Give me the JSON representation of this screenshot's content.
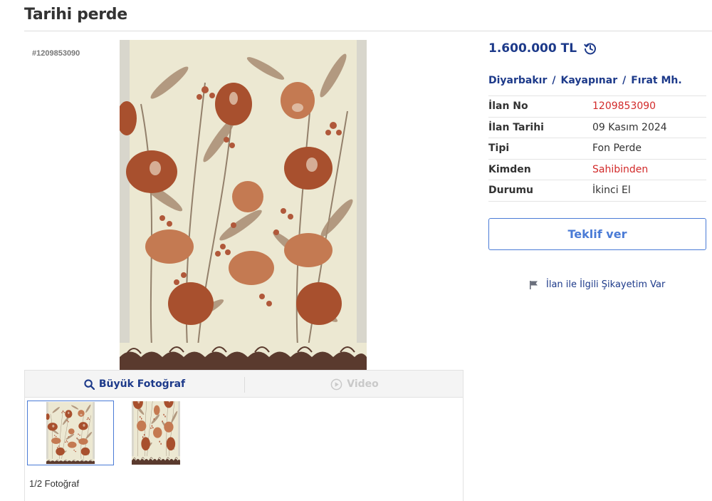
{
  "page": {
    "title": "Tarihi perde"
  },
  "listing": {
    "code": "#1209853090"
  },
  "gallery": {
    "big_photo_label": "Büyük Fotoğraf",
    "video_label": "Video",
    "counter": "1/2 Fotoğraf"
  },
  "price": {
    "amount": "1.600.000 TL"
  },
  "location": {
    "city": "Diyarbakır",
    "district": "Kayapınar",
    "neighborhood": "Fırat Mh.",
    "separator": "/"
  },
  "details": [
    {
      "label": "İlan No",
      "value": "1209853090"
    },
    {
      "label": "İlan Tarihi",
      "value": "09 Kasım 2024"
    },
    {
      "label": "Tipi",
      "value": "Fon Perde"
    },
    {
      "label": "Kimden",
      "value": "Sahibinden"
    },
    {
      "label": "Durumu",
      "value": "İkinci El"
    }
  ],
  "actions": {
    "offer_label": "Teklif ver",
    "report_label": "İlan ile İlgili Şikayetim Var"
  },
  "colors": {
    "brand_blue": "#1d3a8a",
    "link_blue": "#4a7bd6",
    "highlight_red": "#d22a2a"
  },
  "icons": {
    "search": "search-icon",
    "video": "play-circle-icon",
    "history": "price-history-icon",
    "flag": "flag-icon"
  }
}
